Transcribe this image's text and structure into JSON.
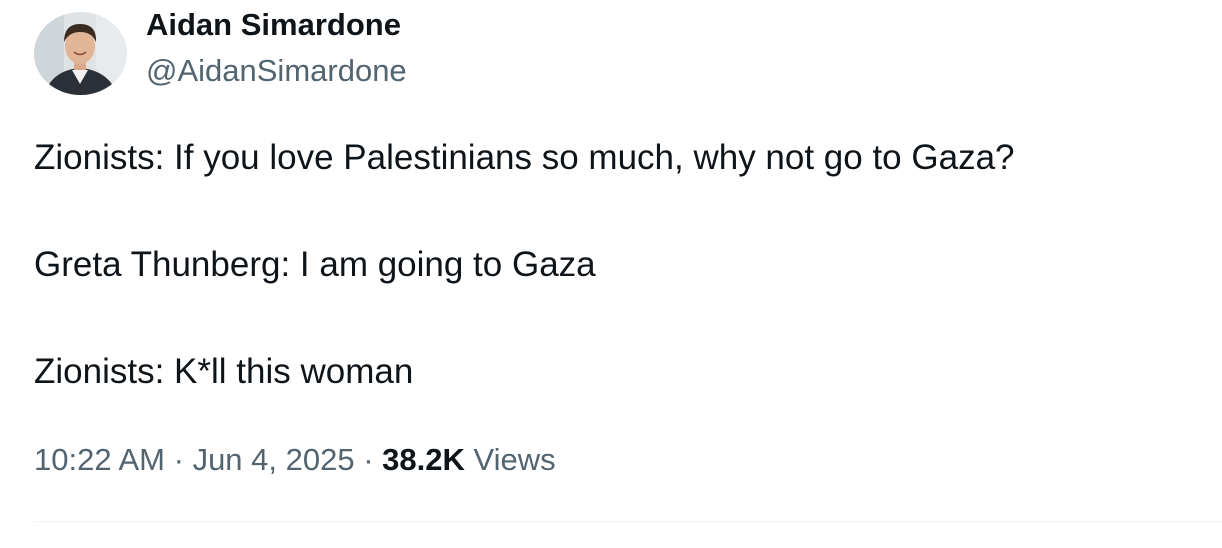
{
  "author": {
    "display_name": "Aidan Simardone",
    "handle": "@AidanSimardone",
    "avatar_icon": "profile-photo"
  },
  "tweet": {
    "lines": [
      "Zionists: If you love Palestinians so much, why not go to Gaza?",
      "Greta Thunberg: I am going to Gaza",
      "Zionists: K*ll this woman"
    ]
  },
  "meta": {
    "time": "10:22 AM",
    "separator": "·",
    "date": "Jun 4, 2025",
    "views_count": "38.2K",
    "views_label": "Views"
  },
  "colors": {
    "text_primary": "#0f1419",
    "text_secondary": "#536471",
    "divider": "#eff3f4",
    "background": "#ffffff"
  }
}
